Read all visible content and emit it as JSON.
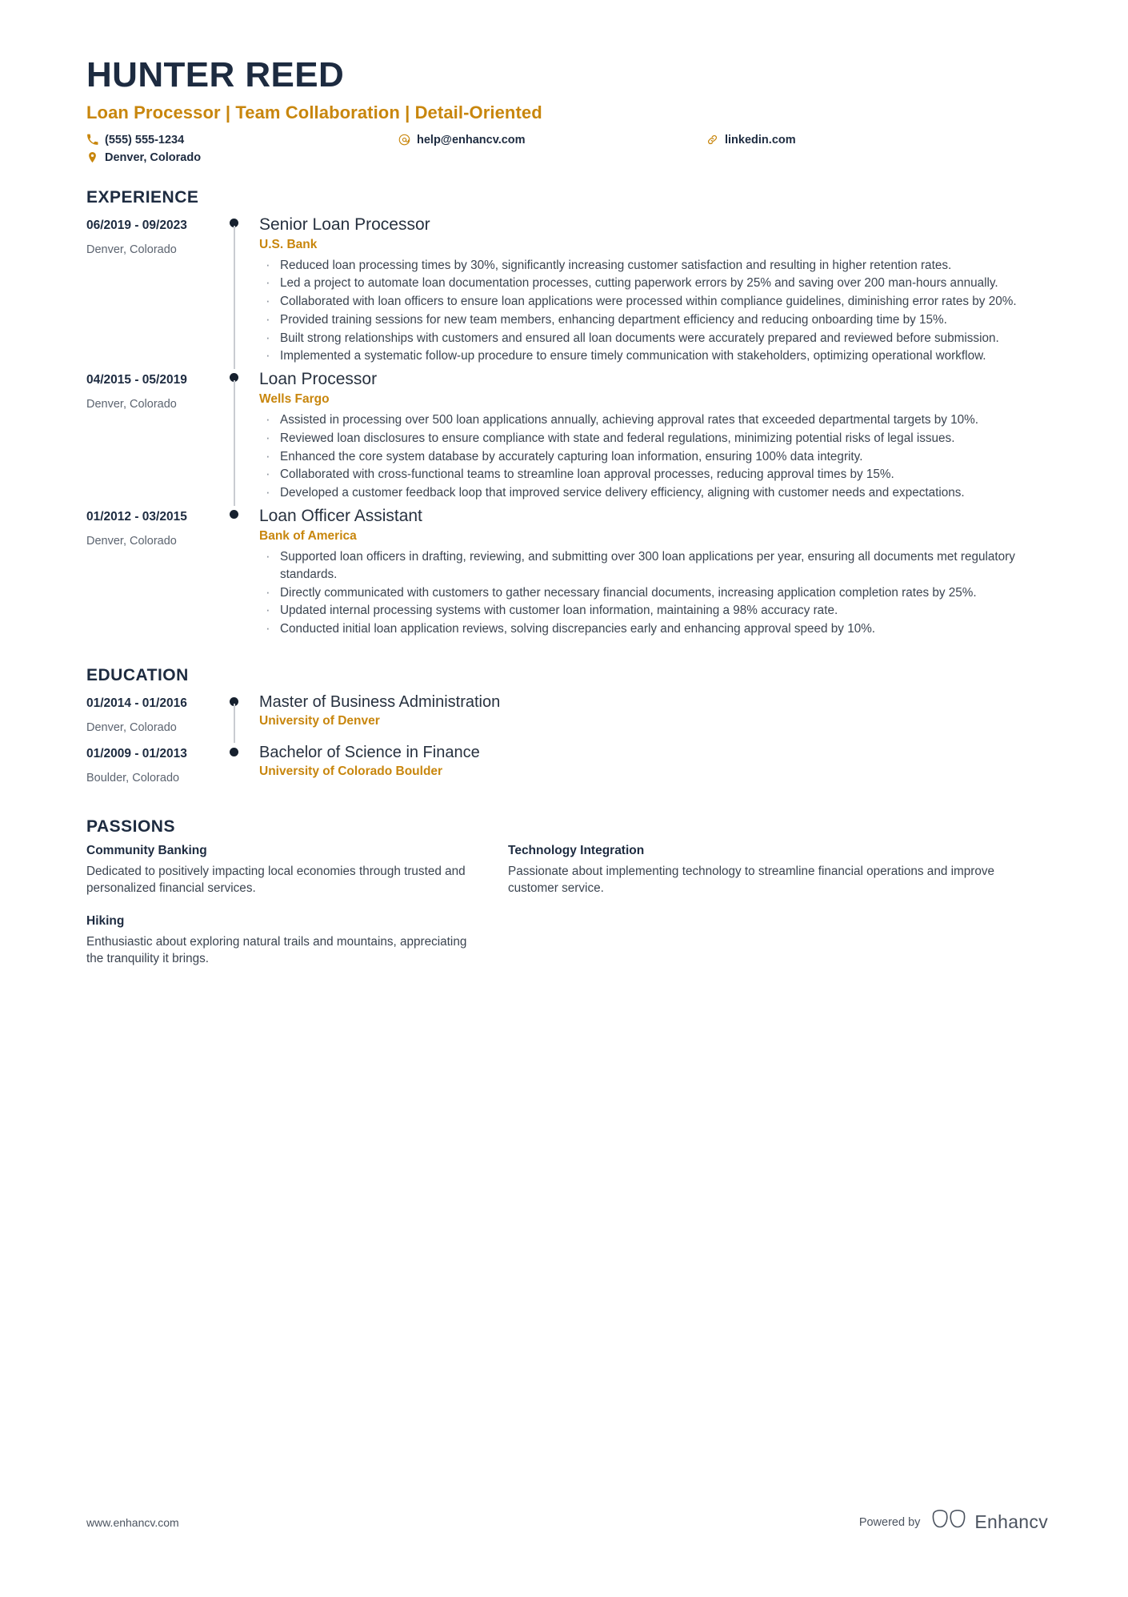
{
  "colors": {
    "navy": "#1d2b40",
    "gold": "#c8860d",
    "body_text": "#3b4450",
    "muted": "#5c6470"
  },
  "header": {
    "name": "HUNTER REED",
    "headline": "Loan Processor | Team Collaboration | Detail-Oriented",
    "contacts": [
      {
        "icon": "phone-icon",
        "text": "(555) 555-1234"
      },
      {
        "icon": "email-icon",
        "text": "help@enhancv.com"
      },
      {
        "icon": "link-icon",
        "text": "linkedin.com"
      },
      {
        "icon": "location-icon",
        "text": "Denver, Colorado"
      }
    ]
  },
  "experience": {
    "title": "EXPERIENCE",
    "entries": [
      {
        "date": "06/2019 - 09/2023",
        "location": "Denver, Colorado",
        "job_title": "Senior Loan Processor",
        "company": "U.S. Bank",
        "bullets": [
          "Reduced loan processing times by 30%, significantly increasing customer satisfaction and resulting in higher retention rates.",
          "Led a project to automate loan documentation processes, cutting paperwork errors by 25% and saving over 200 man-hours annually.",
          "Collaborated with loan officers to ensure loan applications were processed within compliance guidelines, diminishing error rates by 20%.",
          "Provided training sessions for new team members, enhancing department efficiency and reducing onboarding time by 15%.",
          "Built strong relationships with customers and ensured all loan documents were accurately prepared and reviewed before submission.",
          "Implemented a systematic follow-up procedure to ensure timely communication with stakeholders, optimizing operational workflow."
        ]
      },
      {
        "date": "04/2015 - 05/2019",
        "location": "Denver, Colorado",
        "job_title": "Loan Processor",
        "company": "Wells Fargo",
        "bullets": [
          "Assisted in processing over 500 loan applications annually, achieving approval rates that exceeded departmental targets by 10%.",
          "Reviewed loan disclosures to ensure compliance with state and federal regulations, minimizing potential risks of legal issues.",
          "Enhanced the core system database by accurately capturing loan information, ensuring 100% data integrity.",
          "Collaborated with cross-functional teams to streamline loan approval processes, reducing approval times by 15%.",
          "Developed a customer feedback loop that improved service delivery efficiency, aligning with customer needs and expectations."
        ]
      },
      {
        "date": "01/2012 - 03/2015",
        "location": "Denver, Colorado",
        "job_title": "Loan Officer Assistant",
        "company": "Bank of America",
        "bullets": [
          "Supported loan officers in drafting, reviewing, and submitting over 300 loan applications per year, ensuring all documents met regulatory standards.",
          "Directly communicated with customers to gather necessary financial documents, increasing application completion rates by 25%.",
          "Updated internal processing systems with customer loan information, maintaining a 98% accuracy rate.",
          "Conducted initial loan application reviews, solving discrepancies early and enhancing approval speed by 10%."
        ]
      }
    ]
  },
  "education": {
    "title": "EDUCATION",
    "entries": [
      {
        "date": "01/2014 - 01/2016",
        "location": "Denver, Colorado",
        "degree": "Master of Business Administration",
        "school": "University of Denver"
      },
      {
        "date": "01/2009 - 01/2013",
        "location": "Boulder, Colorado",
        "degree": "Bachelor of Science in Finance",
        "school": "University of Colorado Boulder"
      }
    ]
  },
  "passions": {
    "title": "PASSIONS",
    "items": [
      {
        "title": "Community Banking",
        "text": "Dedicated to positively impacting local economies through trusted and personalized financial services."
      },
      {
        "title": "Technology Integration",
        "text": "Passionate about implementing technology to streamline financial operations and improve customer service."
      },
      {
        "title": "Hiking",
        "text": "Enthusiastic about exploring natural trails and mountains, appreciating the tranquility it brings."
      }
    ]
  },
  "footer": {
    "url": "www.enhancv.com",
    "powered_by": "Powered by",
    "brand": "Enhancv"
  }
}
